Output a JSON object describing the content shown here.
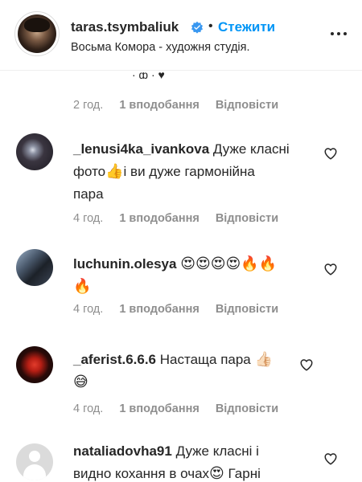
{
  "header": {
    "username": "taras.tsymbaliuk",
    "separator": "•",
    "follow_label": "Стежити",
    "bio": "Восьма Комора - художня студія."
  },
  "icons": {
    "verified": "verified-badge-icon",
    "more": "more-options-icon",
    "heart": "heart-outline-icon"
  },
  "colors": {
    "link_blue": "#0095f6",
    "text": "#262626",
    "secondary": "#8e8e8e",
    "verified": "#3897f0"
  },
  "previous_comment": {
    "fragment": "· ф · ♥",
    "time": "2 год.",
    "likes": "1 вподобання",
    "reply": "Відповісти"
  },
  "comments": [
    {
      "username": "_lenusi4ka_ivankova",
      "text_line1": "Дуже класні",
      "text_line2a": "фото",
      "emoji1": "👍",
      "text_line2b": "і ви дуже гармонійна",
      "text_line3": "пара",
      "time": "4 год.",
      "likes": "1 вподобання",
      "reply": "Відповісти"
    },
    {
      "username": "luchunin.olesya",
      "emojis_line1": "😍😍😍😍🔥🔥",
      "emojis_line2": "🔥",
      "time": "4 год.",
      "likes": "1 вподобання",
      "reply": "Відповісти"
    },
    {
      "username": "_aferist.6.6.6",
      "text": "Настаща пара",
      "emoji1": "👍🏻",
      "emoji2": "😅",
      "time": "4 год.",
      "likes": "1 вподобання",
      "reply": "Відповісти"
    },
    {
      "username": "nataliadovha91",
      "text_line1": "Дуже класні і",
      "text_line2": "видно кохання в очах",
      "emoji1": "😍",
      "text_line2b": "Гарні"
    }
  ]
}
